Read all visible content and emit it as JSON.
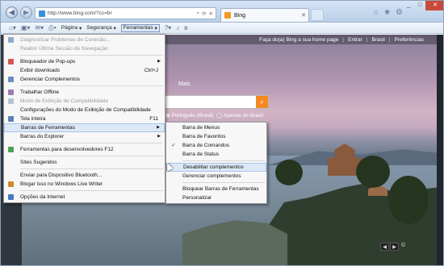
{
  "browser": {
    "address": {
      "url": "http://www.bing.com/?cc=br"
    },
    "tab": {
      "label": "Bing"
    },
    "commandbar": {
      "page_label": "Página",
      "security_label": "Segurança",
      "tools_label": "Ferramentas"
    }
  },
  "bing": {
    "toplinks": [
      "Faça do(a) Bing a sua home page",
      "|",
      "Entrar",
      "|",
      "Brasil",
      "|",
      "Preferências"
    ],
    "more_label": "Mais",
    "scope_label": "Português (Brasil)",
    "scope_label2": "Apenas do Brasil",
    "copyright": "©"
  },
  "tools_menu": {
    "items": [
      {
        "label": "Diagnosticar Problemas de Conexão...",
        "disabled": true,
        "icon": "diagnose-icon"
      },
      {
        "label": "Reabrir Última Sessão de Navegação",
        "disabled": true
      },
      {
        "sep": true
      },
      {
        "label": "Bloqueador de Pop-ups",
        "arrow": true,
        "icon": "popup-blocker-icon"
      },
      {
        "label": "Exibir downloads",
        "shortcut": "Ctrl+J"
      },
      {
        "label": "Gerenciar Complementos",
        "icon": "addons-icon"
      },
      {
        "sep": true
      },
      {
        "label": "Trabalhar Offline",
        "icon": "offline-icon"
      },
      {
        "label": "Modo de Exibição de Compatibilidade",
        "disabled": true,
        "icon": "compat-icon"
      },
      {
        "label": "Configurações do Modo de Exibição de Compatibilidade"
      },
      {
        "label": "Tela inteira",
        "shortcut": "F11",
        "icon": "fullscreen-icon"
      },
      {
        "label": "Barras de Ferramentas",
        "arrow": true,
        "highlight": true
      },
      {
        "label": "Barras do Explorer",
        "arrow": true
      },
      {
        "sep": true
      },
      {
        "label": "Ferramentas para desenvolvedores F12",
        "icon": "devtools-icon"
      },
      {
        "sep": true
      },
      {
        "label": "Sites Sugeridos"
      },
      {
        "sep": true
      },
      {
        "label": "Enviar para Dispositivo Bluetooth..."
      },
      {
        "label": "Blogar isso no Windows Live Writer",
        "icon": "writer-icon"
      },
      {
        "sep": true
      },
      {
        "label": "Opções da Internet",
        "icon": "options-icon"
      }
    ]
  },
  "toolbars_submenu": {
    "items": [
      {
        "label": "Barra de Menus"
      },
      {
        "label": "Barra de Favoritos"
      },
      {
        "label": "Barra de Comandos",
        "checked": true
      },
      {
        "label": "Barra de Status"
      },
      {
        "sep": true
      },
      {
        "label": "Desabilitar complementos",
        "highlight": true
      },
      {
        "label": "Gerenciar complementos"
      },
      {
        "sep": true
      },
      {
        "label": "Bloquear Barras de Ferramentas"
      },
      {
        "label": "Personalizar"
      }
    ]
  },
  "colors": {
    "accent": "#dde8f7",
    "bing_orange": "#f5891f"
  }
}
